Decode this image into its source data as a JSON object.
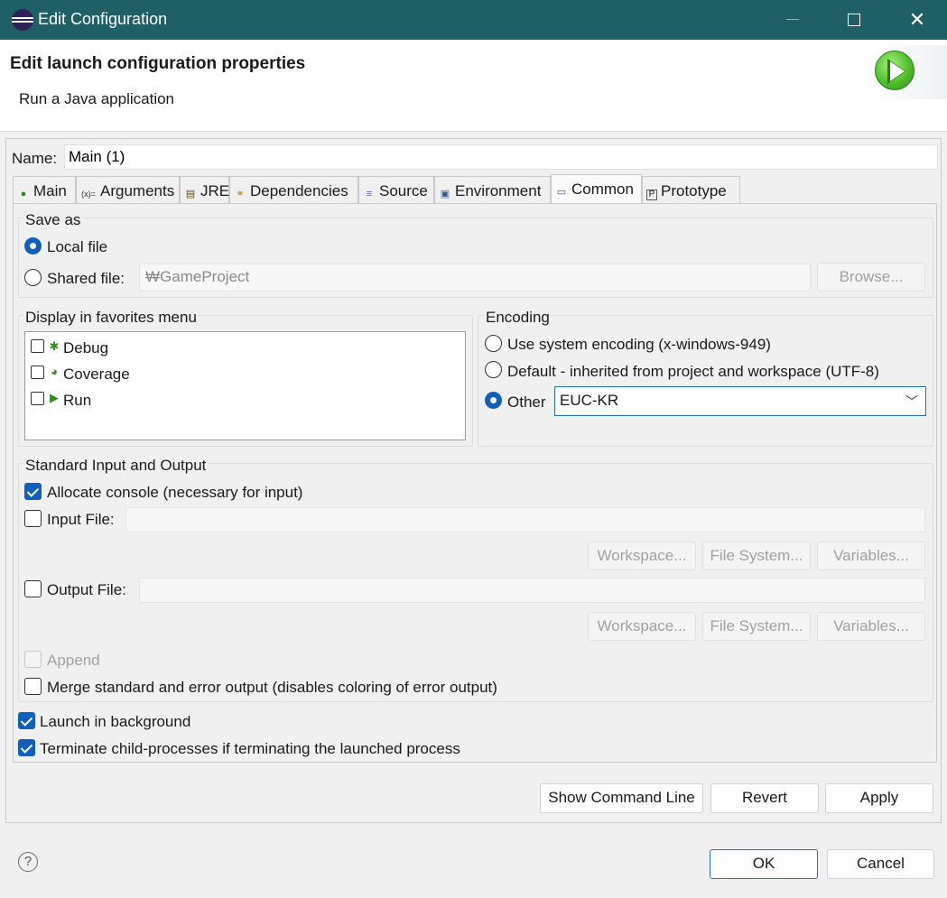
{
  "window": {
    "title": "Edit Configuration",
    "minimize_label": "–",
    "close_label": "✕"
  },
  "header": {
    "title": "Edit launch configuration properties",
    "subtitle": "Run a Java application"
  },
  "name_field": {
    "label": "Name:",
    "value": "Main (1)"
  },
  "tabs": [
    {
      "label": "Main",
      "icon": "main-class-icon",
      "glyph": "●"
    },
    {
      "label": "Arguments",
      "icon": "arguments-icon",
      "glyph": "(x)="
    },
    {
      "label": "JRE",
      "icon": "jre-icon",
      "glyph": "▤"
    },
    {
      "label": "Dependencies",
      "icon": "dependencies-icon",
      "glyph": "⚭"
    },
    {
      "label": "Source",
      "icon": "source-icon",
      "glyph": "≡"
    },
    {
      "label": "Environment",
      "icon": "environment-icon",
      "glyph": "▣"
    },
    {
      "label": "Common",
      "icon": "common-icon",
      "glyph": "▭",
      "active": true
    },
    {
      "label": "Prototype",
      "icon": "prototype-icon",
      "glyph": "P"
    }
  ],
  "save_as": {
    "title": "Save as",
    "local_file_label": "Local file",
    "local_file_selected": true,
    "shared_file_label": "Shared file:",
    "shared_file_value": "₩GameProject",
    "browse_label": "Browse..."
  },
  "favorites": {
    "title": "Display in favorites menu",
    "items": [
      {
        "label": "Debug",
        "icon": "debug-icon",
        "checked": false
      },
      {
        "label": "Coverage",
        "icon": "coverage-icon",
        "checked": false
      },
      {
        "label": "Run",
        "icon": "run-icon",
        "checked": false
      }
    ]
  },
  "encoding": {
    "title": "Encoding",
    "system_label": "Use system encoding (x-windows-949)",
    "default_label": "Default - inherited from project and workspace (UTF-8)",
    "other_label": "Other",
    "other_selected": true,
    "other_value": "EUC-KR"
  },
  "std_io": {
    "title": "Standard Input and Output",
    "allocate_console_label": "Allocate console (necessary for input)",
    "allocate_console_checked": true,
    "input_file_label": "Input File:",
    "output_file_label": "Output File:",
    "workspace_label": "Workspace...",
    "file_system_label": "File System...",
    "variables_label": "Variables...",
    "append_label": "Append",
    "merge_label": "Merge standard and error output (disables coloring of error output)"
  },
  "launch_background_label": "Launch in background",
  "launch_background_checked": true,
  "terminate_children_label": "Terminate child-processes if terminating the launched process",
  "terminate_children_checked": true,
  "buttons": {
    "show_command_line": "Show Command Line",
    "revert": "Revert",
    "apply": "Apply",
    "ok": "OK",
    "cancel": "Cancel",
    "help": "?"
  }
}
